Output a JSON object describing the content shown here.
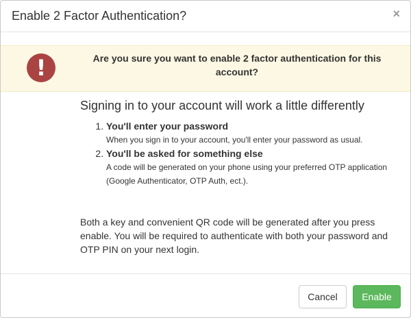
{
  "dialog": {
    "title": "Enable 2 Factor Authentication?",
    "close_label": "×"
  },
  "warning": {
    "icon": "exclamation-icon",
    "icon_glyph": "!",
    "icon_color": "#a94442",
    "background_color": "#fcf8e3",
    "message": "Are you sure you want to enable 2 factor authentication for this account?"
  },
  "body": {
    "lead": "Signing in to your account will work a little differently",
    "steps": [
      {
        "title": "You'll enter your password",
        "description": "When you sign in to your account, you'll enter your password as usual."
      },
      {
        "title": "You'll be asked for something else",
        "description": "A code will be generated on your phone using your preferred OTP application (Google Authenticator, OTP Auth, ect.)."
      }
    ],
    "footnote": "Both a key and convenient QR code will be generated after you press enable. You will be required to authenticate with both your password and OTP PIN on your next login."
  },
  "footer": {
    "cancel_label": "Cancel",
    "enable_label": "Enable",
    "enable_color": "#5cb85c"
  }
}
